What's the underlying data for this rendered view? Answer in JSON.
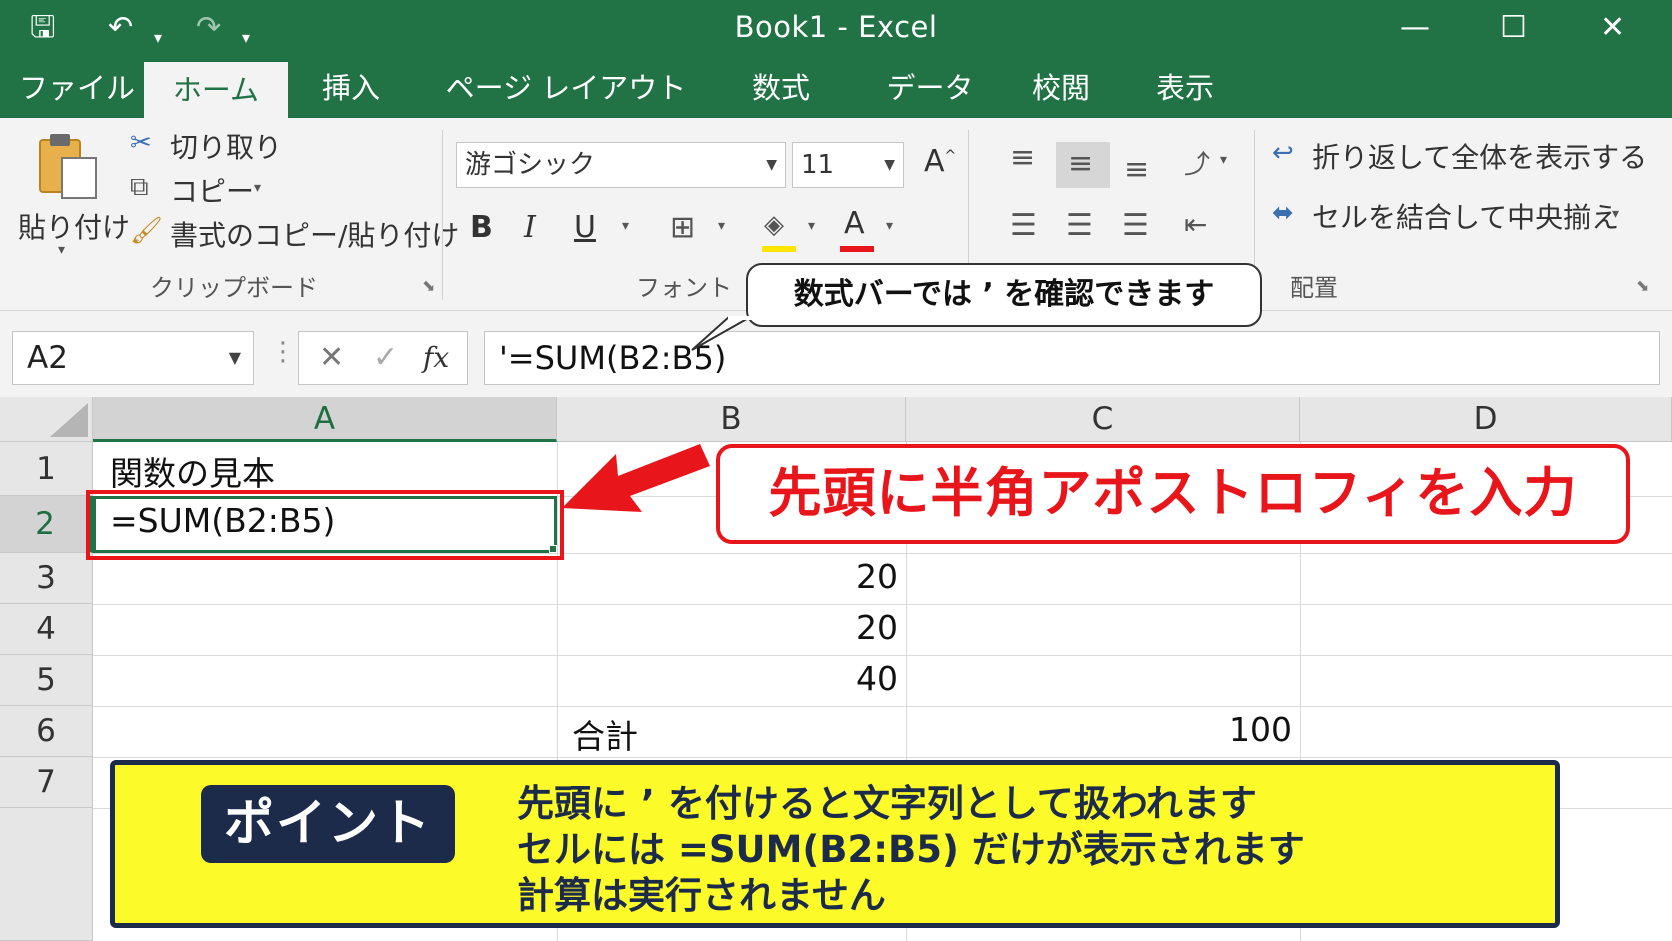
{
  "window": {
    "title": "Book1  -  Excel"
  },
  "quick_access": {
    "save_icon": "save-icon",
    "undo_icon": "undo-icon",
    "redo_icon": "redo-icon"
  },
  "tabs": [
    {
      "label": "ファイル"
    },
    {
      "label": "ホーム"
    },
    {
      "label": "挿入"
    },
    {
      "label": "ページ レイアウト"
    },
    {
      "label": "数式"
    },
    {
      "label": "データ"
    },
    {
      "label": "校閲"
    },
    {
      "label": "表示"
    }
  ],
  "ribbon": {
    "clipboard": {
      "paste": "貼り付け",
      "cut": "切り取り",
      "copy": "コピー",
      "format_painter": "書式のコピー/貼り付け",
      "group_label": "クリップボード"
    },
    "font": {
      "font_name": "游ゴシック",
      "font_size": "11",
      "bold": "B",
      "italic": "I",
      "underline": "U",
      "font_color_letter": "A",
      "grow_letter": "A",
      "group_label": "フォント"
    },
    "alignment": {
      "wrap_text": "折り返して全体を表示する",
      "merge_center": "セルを結合して中央揃え",
      "group_label": "配置"
    }
  },
  "callout": {
    "text": "数式バーでは ’ を確認できます"
  },
  "formula_bar": {
    "name_box": "A2",
    "fx": "fx",
    "formula": "'=SUM(B2:B5)"
  },
  "columns": [
    "A",
    "B",
    "C",
    "D"
  ],
  "rows": [
    "1",
    "2",
    "3",
    "4",
    "5",
    "6",
    "7"
  ],
  "cells": {
    "A1": "関数の見本",
    "A2": "=SUM(B2:B5)",
    "B3": "20",
    "B4": "20",
    "B5": "40",
    "B6": "合計",
    "C6": "100"
  },
  "annotation": {
    "text": "先頭に半角アポストロフィを入力"
  },
  "point": {
    "badge": "ポイント",
    "lines": [
      "先頭に ’ を付けると文字列として扱われます",
      "セルには =SUM(B2:B5) だけが表示されます",
      "計算は実行されません"
    ]
  },
  "colors": {
    "excel_green": "#217346",
    "annotation_red": "#e8151b",
    "point_yellow": "#fdfa2a",
    "point_navy": "#1c2b4a"
  }
}
